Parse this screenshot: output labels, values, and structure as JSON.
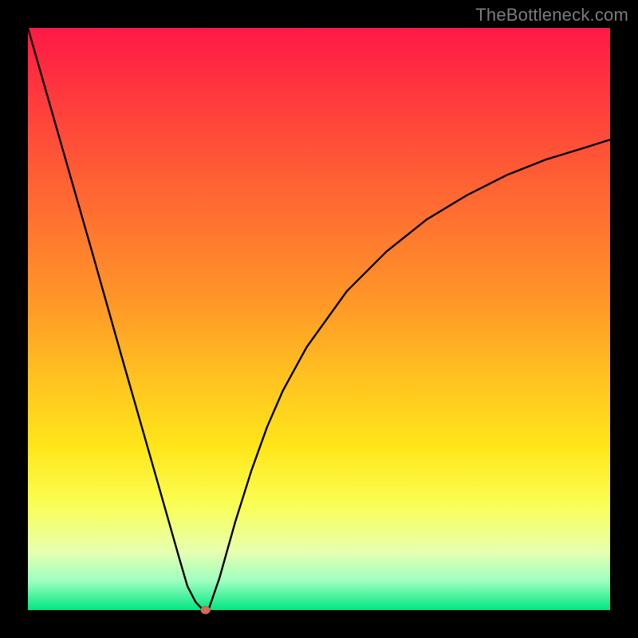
{
  "watermark": "TheBottleneck.com",
  "accent": "#ff1846",
  "green": "#00e682",
  "chart_data": {
    "type": "line",
    "title": "",
    "xlabel": "",
    "ylabel": "",
    "xlim": [
      0,
      100
    ],
    "ylim": [
      0,
      100
    ],
    "grid": false,
    "series": [
      {
        "name": "bottleneck-curve",
        "color": "#000000",
        "x": [
          0,
          5.5,
          11,
          16.4,
          21.9,
          26.0,
          27.4,
          28.8,
          30.1,
          31,
          32.9,
          35.6,
          38.4,
          41.1,
          43.8,
          47.9,
          54.8,
          61.6,
          68.5,
          75.3,
          82.2,
          89.0,
          95.9,
          100.0
        ],
        "y": [
          100,
          80.8,
          61.6,
          42.5,
          23.3,
          8.9,
          4.1,
          1.4,
          0.0,
          0.0,
          5.5,
          15.1,
          24.0,
          31.5,
          37.7,
          45.2,
          54.8,
          61.6,
          67.1,
          71.2,
          74.7,
          77.4,
          79.5,
          80.8
        ]
      }
    ],
    "marker": {
      "name": "optimal-point",
      "x": 30.5,
      "y": 0.0,
      "color": "#d46a5a",
      "rx": 6,
      "ry": 5
    }
  }
}
